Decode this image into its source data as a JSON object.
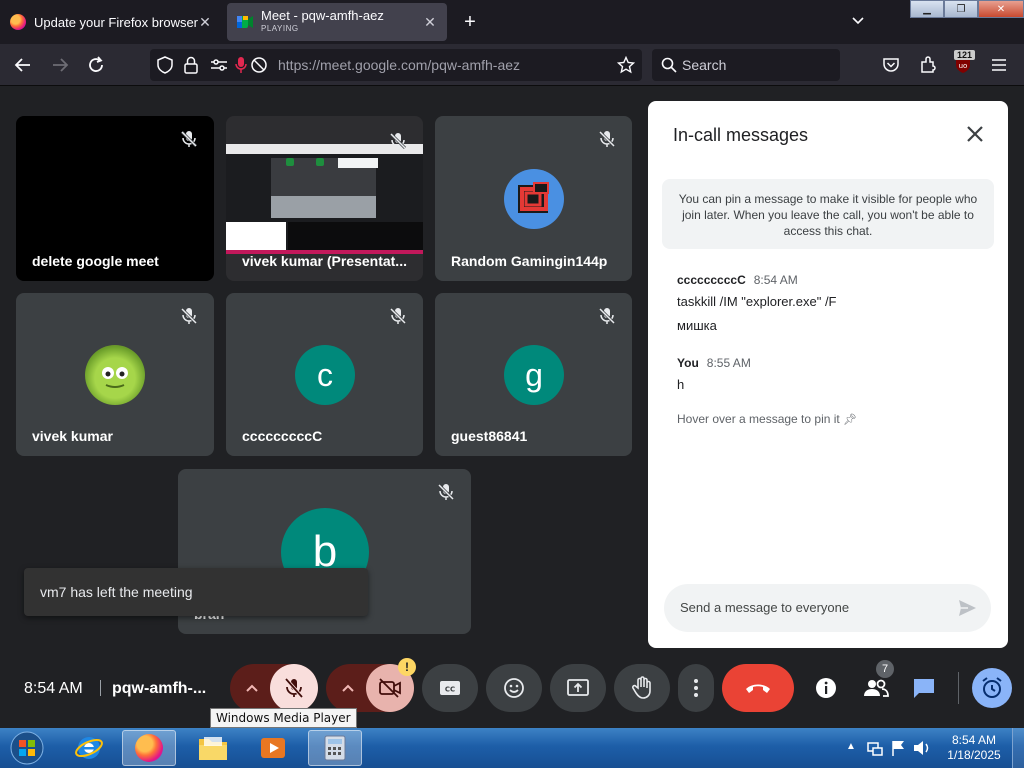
{
  "browser": {
    "tabs": [
      {
        "title": "Update your Firefox browser"
      },
      {
        "title": "Meet - pqw-amfh-aez",
        "status": "PLAYING"
      }
    ],
    "url_host": "https://meet.google.com",
    "url_path": "/pqw-amfh-aez",
    "search_placeholder": "Search",
    "extension_badge": "121"
  },
  "tiles": [
    {
      "name": "delete google meet"
    },
    {
      "name": "vivek kumar (Presentat..."
    },
    {
      "name": "Random Gamingin144p"
    },
    {
      "name": "vivek kumar"
    },
    {
      "name": "cccccccccC",
      "initial": "c"
    },
    {
      "name": "guest86841",
      "initial": "g"
    },
    {
      "name": "bran",
      "initial": "b"
    }
  ],
  "toast": "vm7 has left the meeting",
  "chat": {
    "title": "In-call messages",
    "info": "You can pin a message to make it visible for people who join later. When you leave the call, you won't be able to access this chat.",
    "messages": [
      {
        "sender": "cccccccccC",
        "time": "8:54 AM",
        "lines": [
          "taskkill /IM \"explorer.exe\" /F",
          "мишка"
        ]
      },
      {
        "sender": "You",
        "time": "8:55 AM",
        "lines": [
          "h"
        ]
      }
    ],
    "hover_hint": "Hover over a message to pin it",
    "input_placeholder": "Send a message to everyone"
  },
  "bottombar": {
    "time": "8:54 AM",
    "meeting_code": "pqw-amfh-...",
    "people_count": "7",
    "warning_badge": "!"
  },
  "tooltip": "Windows Media Player",
  "taskbar": {
    "time": "8:54 AM",
    "date": "1/18/2025"
  },
  "colors": {
    "meet_bg": "#202124",
    "tile_bg": "#3c4043",
    "hangup_red": "#ea4335",
    "mic_off_bg": "#f9dedc",
    "teal_avatar": "#00897b",
    "accent_blue": "#8ab4f8"
  }
}
